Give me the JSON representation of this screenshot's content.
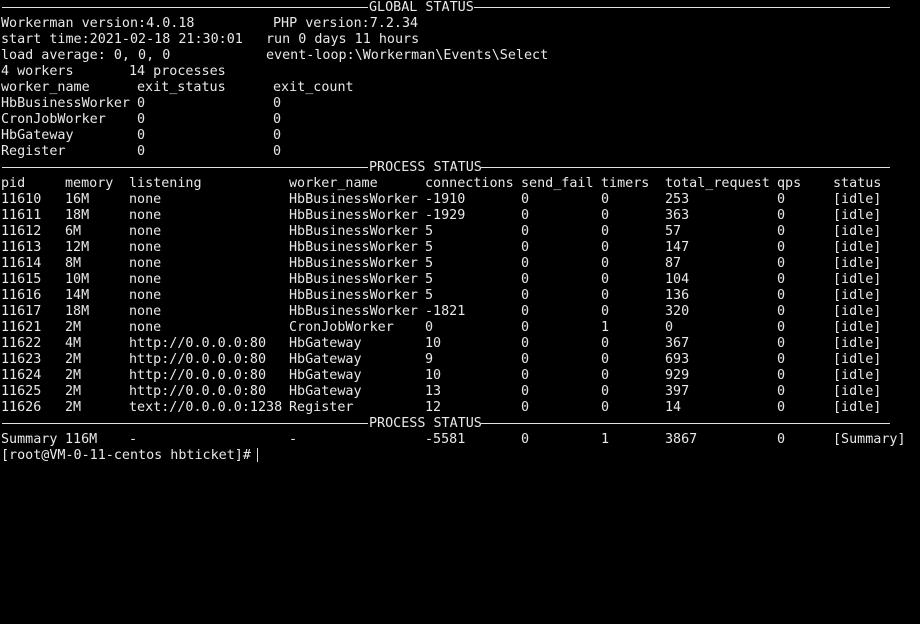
{
  "global_title": "GLOBAL STATUS",
  "process_title": "PROCESS STATUS",
  "info": {
    "workerman_version": "Workerman version:4.0.18",
    "php_version": "PHP version:7.2.34",
    "start_time": "start time:2021-02-18 21:30:01",
    "run_time": "run 0 days 11 hours",
    "load_average": "load average: 0, 0, 0",
    "event_loop": "event-loop:\\Workerman\\Events\\Select",
    "workers": "4 workers",
    "processes": "14 processes"
  },
  "worker_headers": [
    "worker_name",
    "exit_status",
    "exit_count"
  ],
  "workers": [
    {
      "name": "HbBusinessWorker",
      "exit_status": "0",
      "exit_count": "0"
    },
    {
      "name": "CronJobWorker",
      "exit_status": "0",
      "exit_count": "0"
    },
    {
      "name": "HbGateway",
      "exit_status": "0",
      "exit_count": "0"
    },
    {
      "name": "Register",
      "exit_status": "0",
      "exit_count": "0"
    }
  ],
  "process_headers": [
    "pid",
    "memory",
    "listening",
    "worker_name",
    "connections",
    "send_fail",
    "timers",
    "total_request",
    "qps",
    "status"
  ],
  "processes": [
    [
      "11610",
      "16M",
      "none",
      "HbBusinessWorker",
      "-1910",
      "0",
      "0",
      "253",
      "0",
      "[idle]"
    ],
    [
      "11611",
      "18M",
      "none",
      "HbBusinessWorker",
      "-1929",
      "0",
      "0",
      "363",
      "0",
      "[idle]"
    ],
    [
      "11612",
      "6M",
      "none",
      "HbBusinessWorker",
      "5",
      "0",
      "0",
      "57",
      "0",
      "[idle]"
    ],
    [
      "11613",
      "12M",
      "none",
      "HbBusinessWorker",
      "5",
      "0",
      "0",
      "147",
      "0",
      "[idle]"
    ],
    [
      "11614",
      "8M",
      "none",
      "HbBusinessWorker",
      "5",
      "0",
      "0",
      "87",
      "0",
      "[idle]"
    ],
    [
      "11615",
      "10M",
      "none",
      "HbBusinessWorker",
      "5",
      "0",
      "0",
      "104",
      "0",
      "[idle]"
    ],
    [
      "11616",
      "14M",
      "none",
      "HbBusinessWorker",
      "5",
      "0",
      "0",
      "136",
      "0",
      "[idle]"
    ],
    [
      "11617",
      "18M",
      "none",
      "HbBusinessWorker",
      "-1821",
      "0",
      "0",
      "320",
      "0",
      "[idle]"
    ],
    [
      "11621",
      "2M",
      "none",
      "CronJobWorker",
      "0",
      "0",
      "1",
      "0",
      "0",
      "[idle]"
    ],
    [
      "11622",
      "4M",
      "http://0.0.0.0:80",
      "HbGateway",
      "10",
      "0",
      "0",
      "367",
      "0",
      "[idle]"
    ],
    [
      "11623",
      "2M",
      "http://0.0.0.0:80",
      "HbGateway",
      "9",
      "0",
      "0",
      "693",
      "0",
      "[idle]"
    ],
    [
      "11624",
      "2M",
      "http://0.0.0.0:80",
      "HbGateway",
      "10",
      "0",
      "0",
      "929",
      "0",
      "[idle]"
    ],
    [
      "11625",
      "2M",
      "http://0.0.0.0:80",
      "HbGateway",
      "13",
      "0",
      "0",
      "397",
      "0",
      "[idle]"
    ],
    [
      "11626",
      "2M",
      "text://0.0.0.0:1238",
      "Register",
      "12",
      "0",
      "0",
      "14",
      "0",
      "[idle]"
    ]
  ],
  "summary": [
    "Summary",
    "116M",
    "-",
    "-",
    "-5581",
    "0",
    "1",
    "3867",
    "0",
    "[Summary]"
  ],
  "prompt": "[root@VM-0-11-centos hbticket]# "
}
